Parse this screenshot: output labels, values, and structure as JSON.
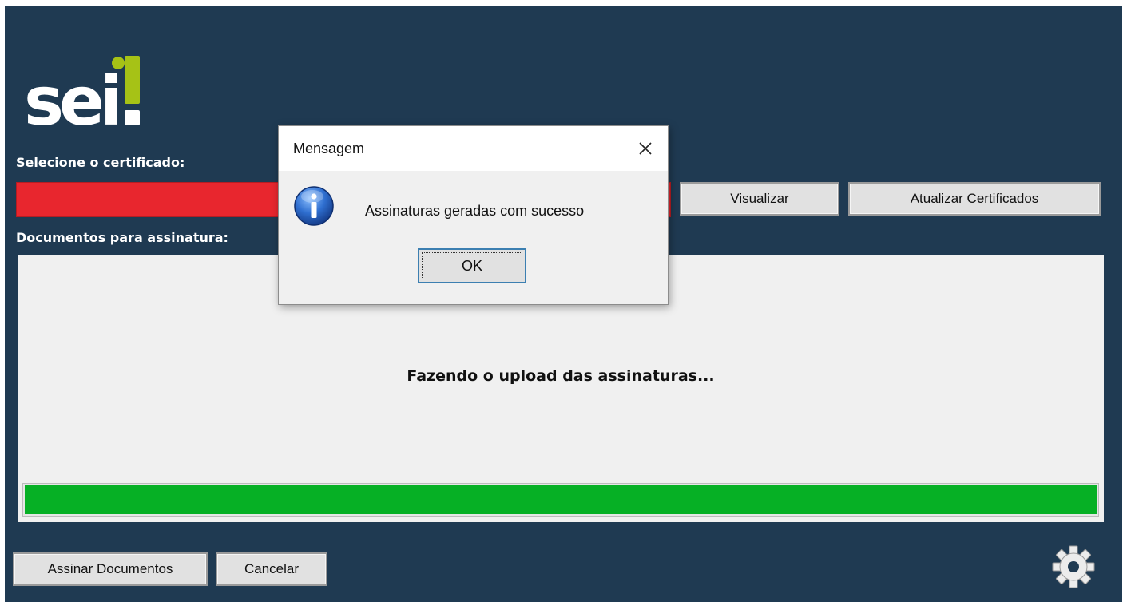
{
  "app": {
    "logo_text": "sei!",
    "certificate_label": "Selecione o certificado:",
    "documents_label": "Documentos para assinatura:",
    "buttons": {
      "view": "Visualizar",
      "refresh": "Atualizar Certificados",
      "sign": "Assinar Documentos",
      "cancel": "Cancelar"
    },
    "upload_status": "Fazendo o upload das assinaturas...",
    "progress_percent": 100,
    "colors": {
      "background": "#1f3a52",
      "certificate_select": "#e8262e",
      "progress": "#06b025",
      "logo_accent": "#a6c216"
    }
  },
  "dialog": {
    "title": "Mensagem",
    "message": "Assinaturas geradas com sucesso",
    "ok_label": "OK",
    "icon": "info-icon",
    "close_icon": "close-icon"
  },
  "icons": {
    "settings": "gear-icon"
  }
}
